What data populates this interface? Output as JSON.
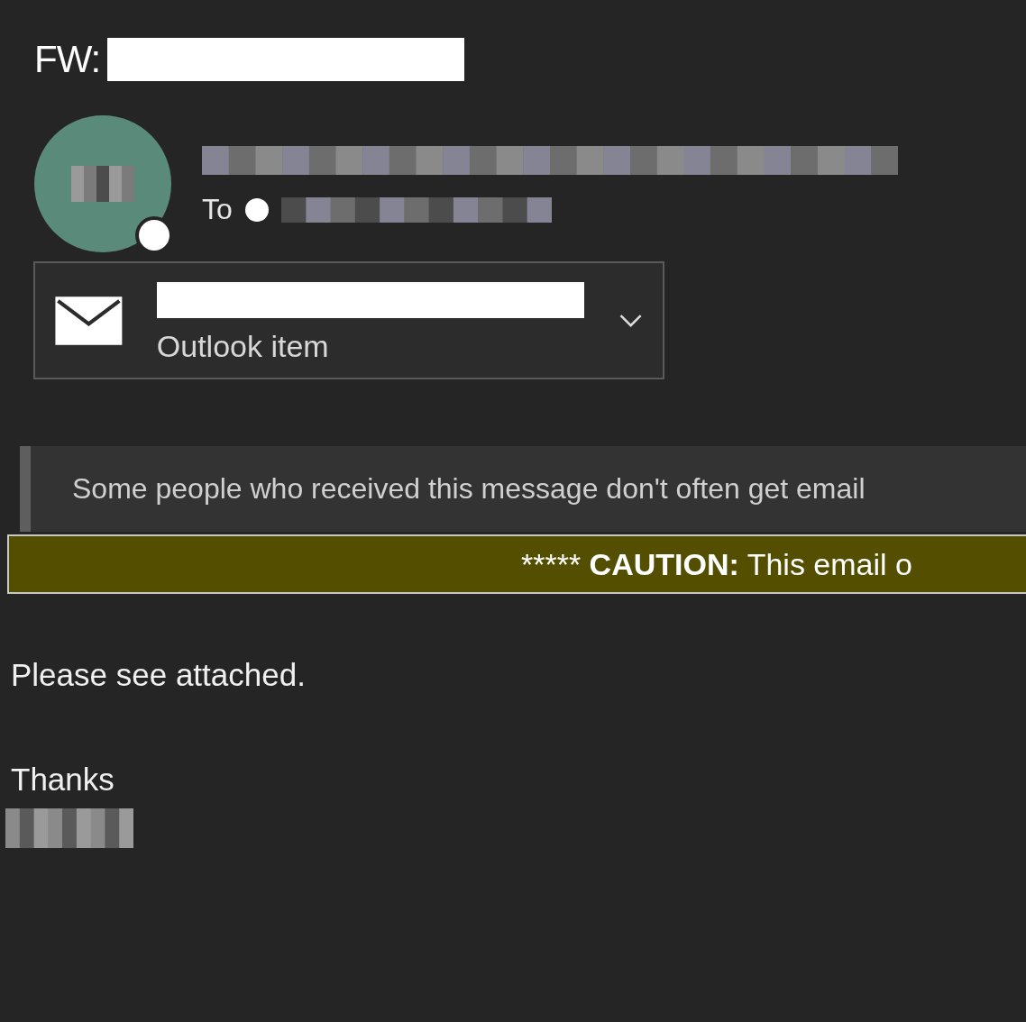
{
  "subject": {
    "prefix": "FW:"
  },
  "recipients": {
    "label": "To"
  },
  "attachment": {
    "type": "Outlook item"
  },
  "notice": {
    "text": "Some people who received this message don't often get email"
  },
  "caution": {
    "stars": "*****",
    "label": "CAUTION:",
    "text": "This email o"
  },
  "body": {
    "lines": [
      "Please see attached.",
      "Thanks"
    ]
  }
}
